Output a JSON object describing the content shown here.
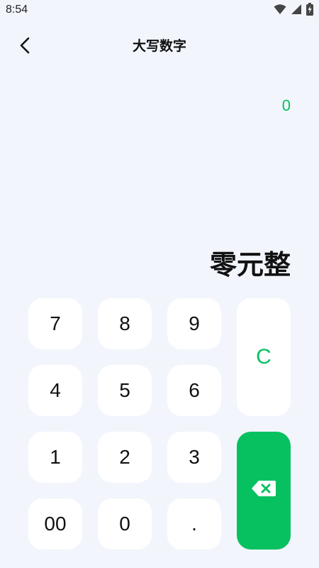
{
  "status_bar": {
    "time": "8:54"
  },
  "app_bar": {
    "title": "大写数字",
    "back_icon": "chevron-left-icon"
  },
  "display": {
    "input_value": "0",
    "result_text": "零元整"
  },
  "keypad": {
    "key_7": "7",
    "key_8": "8",
    "key_9": "9",
    "key_4": "4",
    "key_5": "5",
    "key_6": "6",
    "key_1": "1",
    "key_2": "2",
    "key_3": "3",
    "key_00": "00",
    "key_0": "0",
    "key_dot": ".",
    "clear_label": "C",
    "delete_icon": "backspace-icon"
  },
  "colors": {
    "accent": "#07c160",
    "background": "#f2f5fc",
    "key_background": "#ffffff"
  }
}
